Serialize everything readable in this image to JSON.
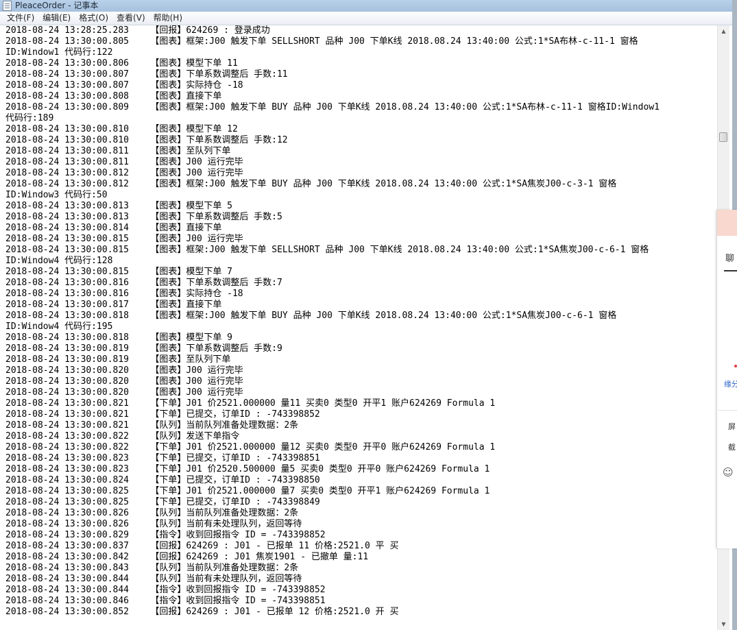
{
  "window": {
    "title": "PleaceOrder - 记事本"
  },
  "menubar": {
    "items": [
      "文件(F)",
      "编辑(E)",
      "格式(O)",
      "查看(V)",
      "帮助(H)"
    ]
  },
  "lines": [
    "2018-08-24 13:28:25.283    【回报】624269 : 登录成功",
    "2018-08-24 13:30:00.805    【图表】框架:J00 触发下单 SELLSHORT 品种 J00 下单K线 2018.08.24 13:40:00 公式:1*SA布林-c-11-1 窗格",
    "ID:Window1 代码行:122",
    "2018-08-24 13:30:00.806    【图表】模型下单 11",
    "2018-08-24 13:30:00.807    【图表】下单系数调整后 手数:11",
    "2018-08-24 13:30:00.807    【图表】实际持仓 -18",
    "2018-08-24 13:30:00.808    【图表】直接下单",
    "2018-08-24 13:30:00.809    【图表】框架:J00 触发下单 BUY 品种 J00 下单K线 2018.08.24 13:40:00 公式:1*SA布林-c-11-1 窗格ID:Window1",
    "代码行:189",
    "2018-08-24 13:30:00.810    【图表】模型下单 12",
    "2018-08-24 13:30:00.810    【图表】下单系数调整后 手数:12",
    "2018-08-24 13:30:00.811    【图表】至队列下单",
    "2018-08-24 13:30:00.811    【图表】J00 运行完毕",
    "2018-08-24 13:30:00.812    【图表】J00 运行完毕",
    "2018-08-24 13:30:00.812    【图表】框架:J00 触发下单 BUY 品种 J00 下单K线 2018.08.24 13:40:00 公式:1*SA焦炭J00-c-3-1 窗格",
    "ID:Window3 代码行:50",
    "2018-08-24 13:30:00.813    【图表】模型下单 5",
    "2018-08-24 13:30:00.813    【图表】下单系数调整后 手数:5",
    "2018-08-24 13:30:00.814    【图表】直接下单",
    "2018-08-24 13:30:00.815    【图表】J00 运行完毕",
    "2018-08-24 13:30:00.815    【图表】框架:J00 触发下单 SELLSHORT 品种 J00 下单K线 2018.08.24 13:40:00 公式:1*SA焦炭J00-c-6-1 窗格",
    "ID:Window4 代码行:128",
    "2018-08-24 13:30:00.815    【图表】模型下单 7",
    "2018-08-24 13:30:00.816    【图表】下单系数调整后 手数:7",
    "2018-08-24 13:30:00.816    【图表】实际持仓 -18",
    "2018-08-24 13:30:00.817    【图表】直接下单",
    "2018-08-24 13:30:00.818    【图表】框架:J00 触发下单 BUY 品种 J00 下单K线 2018.08.24 13:40:00 公式:1*SA焦炭J00-c-6-1 窗格",
    "ID:Window4 代码行:195",
    "2018-08-24 13:30:00.818    【图表】模型下单 9",
    "2018-08-24 13:30:00.819    【图表】下单系数调整后 手数:9",
    "2018-08-24 13:30:00.819    【图表】至队列下单",
    "2018-08-24 13:30:00.820    【图表】J00 运行完毕",
    "2018-08-24 13:30:00.820    【图表】J00 运行完毕",
    "2018-08-24 13:30:00.820    【图表】J00 运行完毕",
    "2018-08-24 13:30:00.821    【下单】J01 价2521.000000 量11 买卖0 类型0 开平1 账户624269 Formula 1",
    "2018-08-24 13:30:00.821    【下单】已提交，订单ID : -743398852",
    "2018-08-24 13:30:00.821    【队列】当前队列准备处理数据：2条",
    "2018-08-24 13:30:00.822    【队列】发送下单指令",
    "2018-08-24 13:30:00.822    【下单】J01 价2521.000000 量12 买卖0 类型0 开平0 账户624269 Formula 1",
    "2018-08-24 13:30:00.823    【下单】已提交，订单ID : -743398851",
    "2018-08-24 13:30:00.823    【下单】J01 价2520.500000 量5 买卖0 类型0 开平0 账户624269 Formula 1",
    "2018-08-24 13:30:00.824    【下单】已提交，订单ID : -743398850",
    "2018-08-24 13:30:00.825    【下单】J01 价2521.000000 量7 买卖0 类型0 开平1 账户624269 Formula 1",
    "2018-08-24 13:30:00.825    【下单】已提交，订单ID : -743398849",
    "2018-08-24 13:30:00.826    【队列】当前队列准备处理数据：2条",
    "2018-08-24 13:30:00.826    【队列】当前有未处理队列，返回等待",
    "2018-08-24 13:30:00.829    【指令】收到回报指令 ID = -743398852",
    "2018-08-24 13:30:00.837    【回报】624269 : J01 - 已报单 11 价格:2521.0 平 买",
    "2018-08-24 13:30:00.842    【回报】624269 : J01 焦炭1901 - 已撤单 量:11",
    "2018-08-24 13:30:00.843    【队列】当前队列准备处理数据：2条",
    "2018-08-24 13:30:00.844    【队列】当前有未处理队列，返回等待",
    "2018-08-24 13:30:00.844    【指令】收到回报指令 ID = -743398852",
    "2018-08-24 13:30:00.846    【指令】收到回报指令 ID = -743398851",
    "2018-08-24 13:30:00.852    【回报】624269 : J01 - 已报单 12 价格:2521.0 开 买"
  ],
  "side_panel": {
    "tab_label": "聊",
    "link_text": "缘分",
    "items": [
      "屏",
      "截"
    ],
    "emoji_icon": "smiley-icon"
  }
}
